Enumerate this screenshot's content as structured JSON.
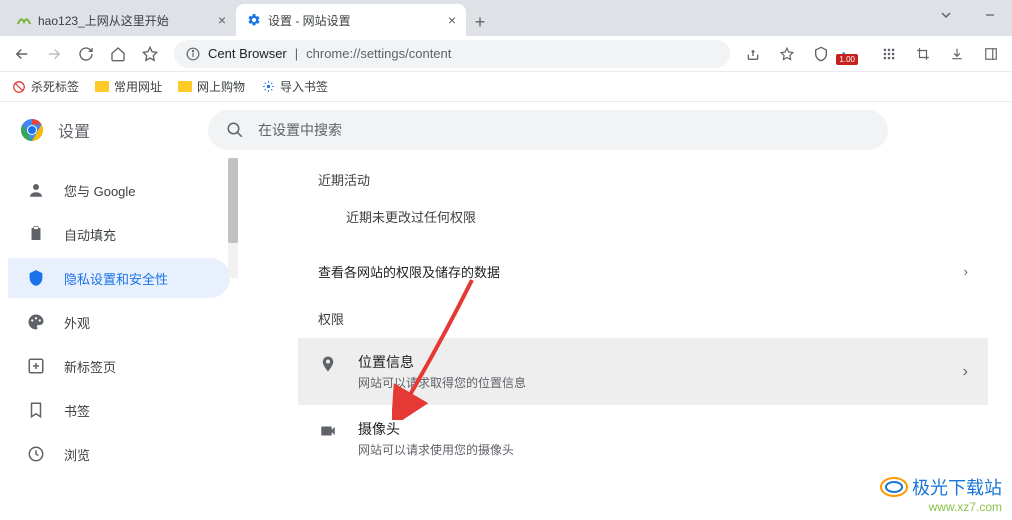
{
  "tabs": [
    {
      "title": "hao123_上网从这里开始"
    },
    {
      "title": "设置 - 网站设置"
    }
  ],
  "address": {
    "brand": "Cent Browser",
    "url": "chrome://settings/content"
  },
  "bookmarks": [
    {
      "label": "杀死标签"
    },
    {
      "label": "常用网址"
    },
    {
      "label": "网上购物"
    },
    {
      "label": "导入书签"
    }
  ],
  "settings": {
    "title": "设置",
    "search_placeholder": "在设置中搜索"
  },
  "sidebar": [
    {
      "label": "您与 Google"
    },
    {
      "label": "自动填充"
    },
    {
      "label": "隐私设置和安全性"
    },
    {
      "label": "外观"
    },
    {
      "label": "新标签页"
    },
    {
      "label": "书签"
    },
    {
      "label": "浏览"
    }
  ],
  "content": {
    "recent_label": "近期活动",
    "recent_text": "近期未更改过任何权限",
    "view_all": "查看各网站的权限及储存的数据",
    "perm_label": "权限",
    "perms": [
      {
        "title": "位置信息",
        "sub": "网站可以请求取得您的位置信息"
      },
      {
        "title": "摄像头",
        "sub": "网站可以请求使用您的摄像头"
      }
    ]
  },
  "badge": "1.00",
  "watermark": {
    "line1": "极光下载站",
    "line2": "www.xz7.com"
  }
}
